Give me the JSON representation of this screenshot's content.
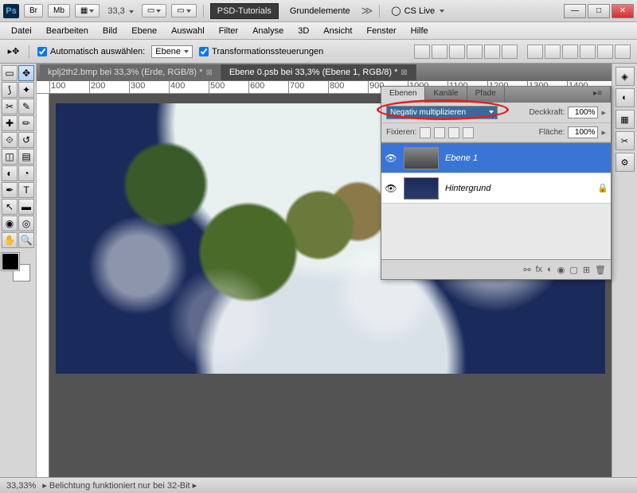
{
  "titlebar": {
    "zoom": "33,3",
    "tutorials": "PSD-Tutorials",
    "grundelemente": "Grundelemente",
    "cslive": "CS Live",
    "buttons": {
      "br": "Br",
      "mb": "Mb"
    }
  },
  "menu": [
    "Datei",
    "Bearbeiten",
    "Bild",
    "Ebene",
    "Auswahl",
    "Filter",
    "Analyse",
    "3D",
    "Ansicht",
    "Fenster",
    "Hilfe"
  ],
  "options": {
    "auto_select": "Automatisch auswählen:",
    "auto_select_val": "Ebene",
    "transform": "Transformationssteuerungen"
  },
  "doc_tabs": [
    "kplj2th2.bmp bei 33,3% (Erde, RGB/8) *",
    "Ebene 0.psb bei 33,3% (Ebene 1, RGB/8) *"
  ],
  "ruler_marks": [
    "100",
    "200",
    "300",
    "400",
    "500",
    "600",
    "700",
    "800",
    "900",
    "1000",
    "1100",
    "1200",
    "1300",
    "1400"
  ],
  "layers_panel": {
    "tabs": [
      "Ebenen",
      "Kanäle",
      "Pfade"
    ],
    "blend_mode": "Negativ multiplizieren",
    "opacity_label": "Deckkraft:",
    "opacity": "100%",
    "lock_label": "Fixieren:",
    "fill_label": "Fläche:",
    "fill": "100%",
    "layers": [
      {
        "name": "Ebene 1",
        "active": true,
        "locked": false
      },
      {
        "name": "Hintergrund",
        "active": false,
        "locked": true
      }
    ]
  },
  "statusbar": {
    "zoom": "33,33%",
    "msg": "Belichtung funktioniert nur bei 32-Bit"
  }
}
